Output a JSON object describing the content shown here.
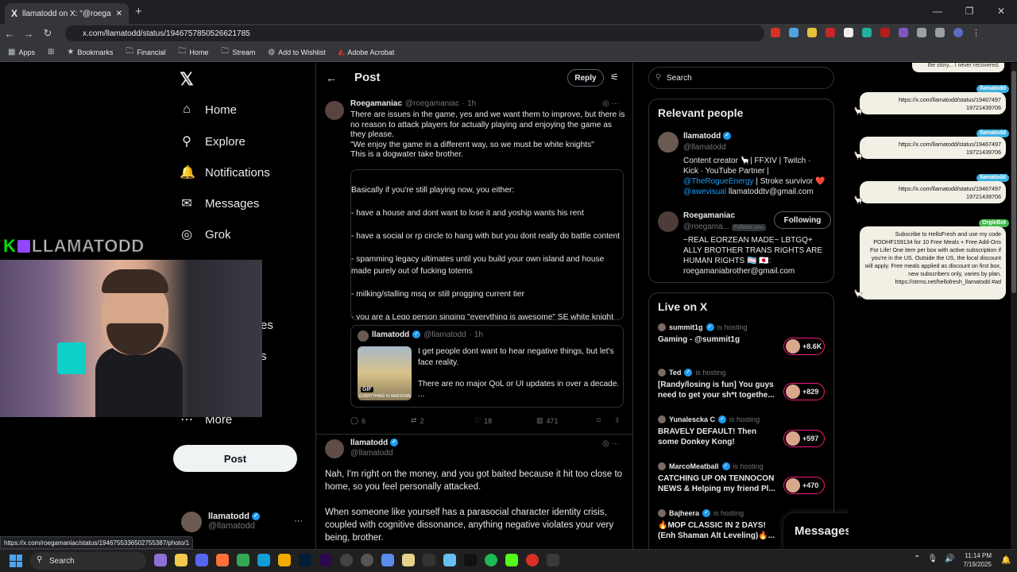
{
  "browser": {
    "tab_title": "llamatodd on X: \"@roegamani…",
    "tab_icon": "X",
    "url": "x.com/llamatodd/status/1946757850526621785",
    "bookmarks": [
      "Apps",
      "Bookmarks",
      "Financial",
      "Home",
      "Stream",
      "Add to Wishlist",
      "Adobe Acrobat"
    ],
    "status_url": "https://x.com/roegamaniac/status/1946755336502755387/photo/1"
  },
  "left_nav": {
    "logo": "𝕏",
    "items": [
      {
        "label": "Home",
        "icon": "⌂"
      },
      {
        "label": "Explore",
        "icon": "⚲"
      },
      {
        "label": "Notifications",
        "icon": "🔔"
      },
      {
        "label": "Messages",
        "icon": "✉"
      },
      {
        "label": "Grok",
        "icon": "◎"
      },
      {
        "label": "es",
        "icon": ""
      },
      {
        "label": "s",
        "icon": ""
      },
      {
        "label": "More",
        "icon": "⋯"
      }
    ],
    "post_label": "Post",
    "account_name": "llamatodd",
    "account_handle": "@llamatodd"
  },
  "webcam": {
    "banner": "LLAMATODD",
    "k_logo": "K"
  },
  "main": {
    "title": "Post",
    "reply_label": "Reply",
    "tweet1": {
      "name": "Roegamaniac",
      "handle": "@roegamaniac",
      "time": "· 1h",
      "text": "There are issues in the game, yes and we want them to improve, but there is no reason to attack players for actually playing and enjoying the game as they please.\n\"We enjoy the game in a different way, so we must be white knights\"\nThis is a dogwater take brother.",
      "image_text": "Basically if you're still playing now, you either:\n\n- have a house and dont want to lose it and yoship wants his rent\n\n- have a social or rp circle to hang with but you dont really do battle content\n\n- spamming legacy ultimates until you build your own island and house made purely out of fucking totems\n\n- milking/stalling msq or still progging current tier\n\n- you are a Lego person singing \"everything is awesome\" SE white knight",
      "quote": {
        "name": "llamatodd",
        "handle": "@llamatodd",
        "time": "· 1h",
        "text": "I get people dont want to hear negative things, but let's face reality.\n\nThere are no major QoL or UI updates in over a decade.\n...",
        "gif_label": "GIF",
        "img_caption": "EVERYTHING IS AWESOME"
      },
      "stats": {
        "replies": "6",
        "reposts": "2",
        "likes": "18",
        "views": "471"
      }
    },
    "tweet2": {
      "name": "llamatodd",
      "handle": "@llamatodd",
      "text": "Nah, I'm right on the money, and you got baited because it hit too close to home, so you feel personally attacked.\n\nWhen someone like yourself has a parasocial character identity crisis, coupled with cognitive dissonance, anything negative violates your very being, brother."
    }
  },
  "right": {
    "search_placeholder": "Search",
    "relevant_title": "Relevant people",
    "people": [
      {
        "name": "llamatodd",
        "handle": "@llamatodd",
        "bio_a": "Content creator 🦙| FFXIV | Twitch · Kick · YouTube Partner |",
        "bio_link1": "@TheRogueEnergy",
        "bio_b": " | Stroke survivor ❤️",
        "bio_link2": "@awevisual",
        "bio_c": " llamatoddtv@gmail.com"
      },
      {
        "name": "Roegamaniac",
        "handle": "@roegama...",
        "follows": "Follows you",
        "button": "Following",
        "bio": "~REAL EORZEAN MADE~ LBTGQ+ ALLY BROTHER TRANS RIGHTS ARE HUMAN RIGHTS 🏳️‍⚧️ 🇯🇵: roegamaniabrother@gmail.com"
      }
    ],
    "live_title": "Live on X",
    "live": [
      {
        "host": "summit1g",
        "status": "is hosting",
        "title": "Gaming - @summit1g",
        "count": "+8.6K"
      },
      {
        "host": "Ted",
        "status": "is hosting",
        "title": "[Randy/losing is fun] You guys need to get your sh*t togethe...",
        "count": "+829"
      },
      {
        "host": "Yunalescka C",
        "status": "is hosting",
        "title": "BRAVELY DEFAULT! Then some Donkey Kong!",
        "count": "+597"
      },
      {
        "host": "MarcoMeatball",
        "status": "is hosting",
        "title": "CATCHING UP ON TENNOCON NEWS & Helping my friend Pl...",
        "count": "+470"
      },
      {
        "host": "Bajheera",
        "status": "is hosting",
        "title": "🔥MOP CLASSIC IN 2 DAYS! (Enh Shaman Alt Leveling)🔥...",
        "count": ""
      }
    ],
    "messages_title": "Messages"
  },
  "chat": {
    "top": "the story... I never recovered.",
    "messages": [
      {
        "user": "llamatodd",
        "text": "https://x.com/llamatodd/status/19467497 19721439706"
      },
      {
        "user": "llamatodd",
        "text": "https://x.com/llamatodd/status/19467497 19721439706"
      },
      {
        "user": "llamatodd",
        "text": "https://x.com/llamatodd/status/19467497 19721439706"
      },
      {
        "user": "OrgieBot",
        "text": "Subscribe to HelloFresh and use my code POOHF159134 for 10 Free Meals + Free Add-Ons For Life! One item per box with active subscription if you're in the US. Outside the US, the local discount will apply. Free meals applied as discount on first box, new subscribers only, varies by plan. https://strms.net/hellofresh_llamatodd #ad"
      }
    ]
  },
  "taskbar": {
    "search": "Search",
    "time": "11:14 PM",
    "date": "7/19/2025"
  },
  "colors": {
    "accent": "#1d9bf0",
    "background": "#000000",
    "live": "#f91880"
  }
}
